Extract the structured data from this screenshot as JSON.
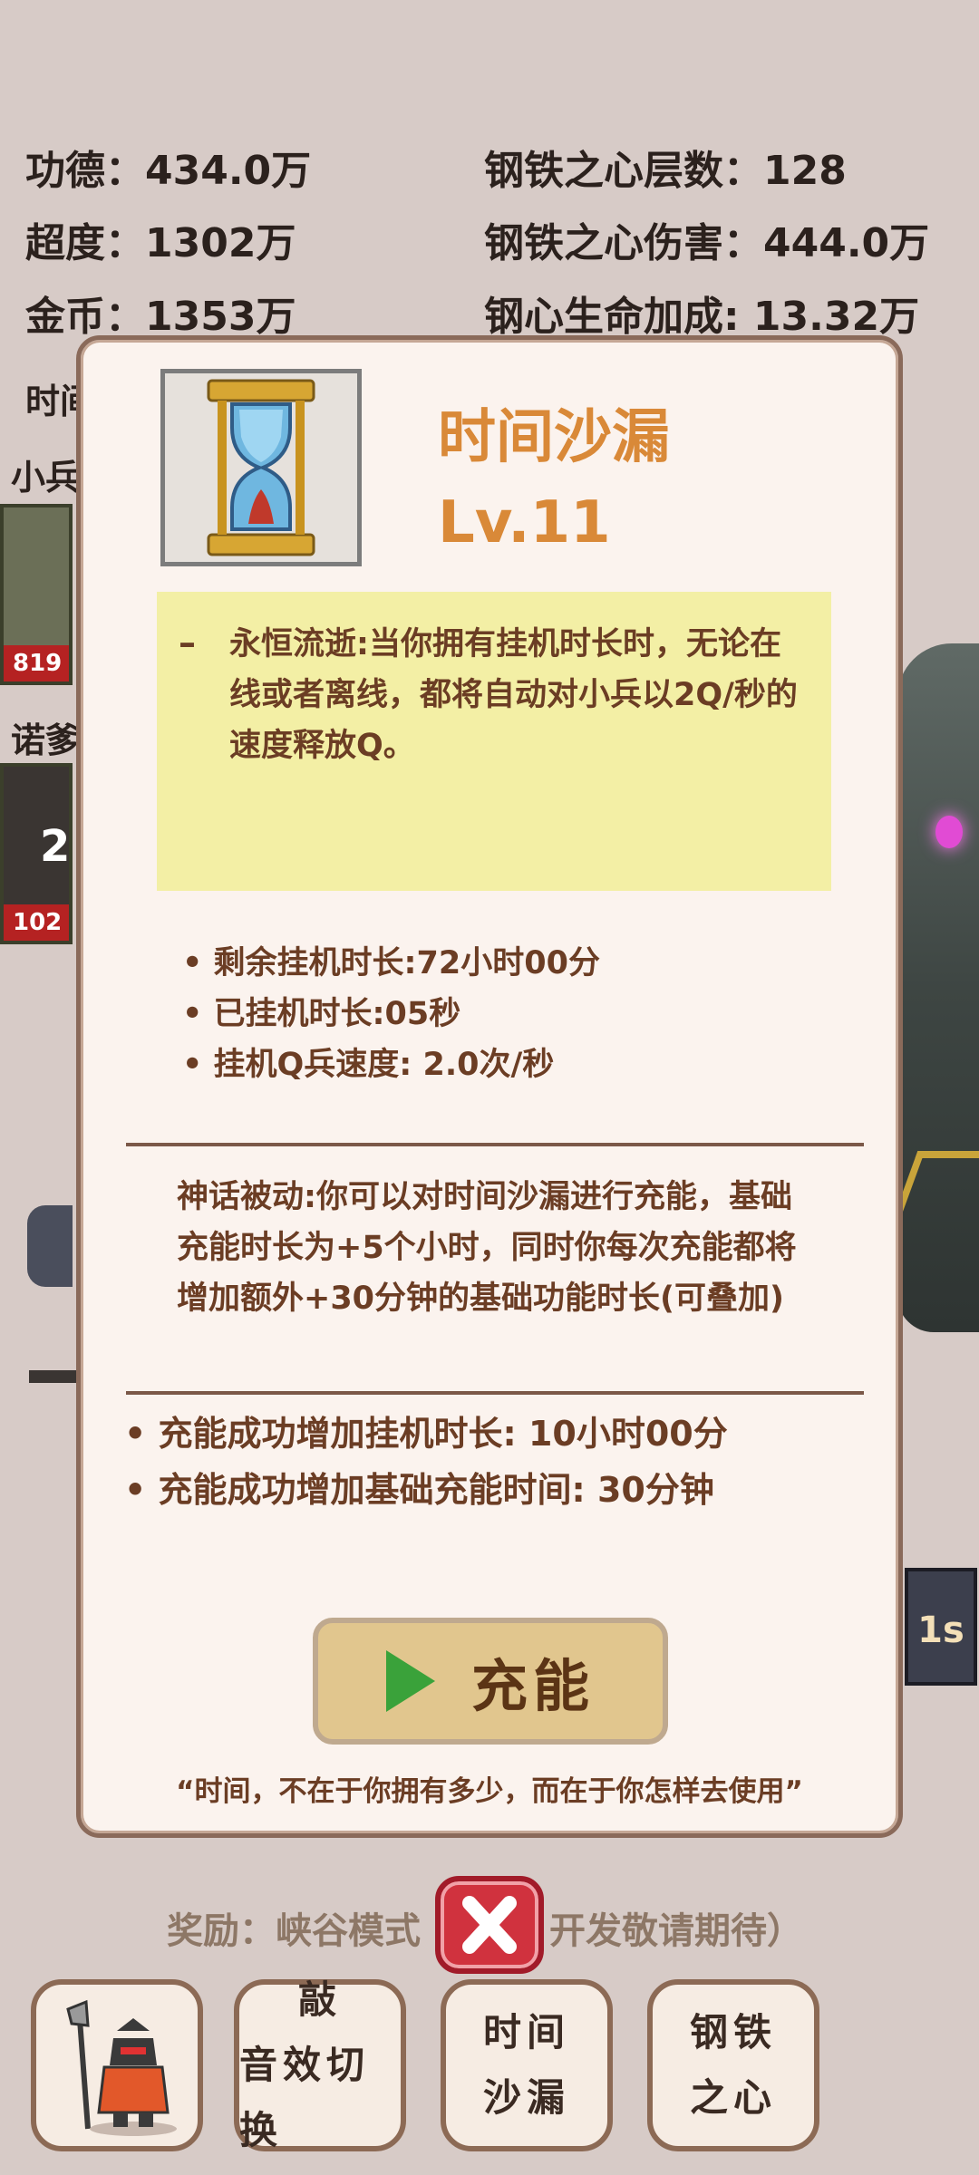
{
  "stats": {
    "merit": "功德：434.0万",
    "transcend": "超度：1302万",
    "gold": "金币：1353万",
    "iron_layers": "钢铁之心层数：128",
    "iron_damage": "钢铁之心伤害：444.0万",
    "iron_life": "钢心生命加成: 13.32万"
  },
  "background": {
    "time_label": "时间",
    "minion_label": "小兵",
    "minion_hp": "819",
    "nuo_label": "诺爹",
    "nuo_level": "2",
    "nuo_hp": "102",
    "small_icon_text": "1s",
    "reward_left": "奖励：峡谷模式",
    "reward_right": "开发敬请期待）"
  },
  "modal": {
    "title": "时间沙漏",
    "level": "Lv.11",
    "desc_dash": "–",
    "desc": "永恒流逝:当你拥有挂机时长时，无论在线或者离线，都将自动对小兵以2Q/秒的速度释放Q。",
    "stats": [
      "• 剩余挂机时长:72小时00分",
      "• 已挂机时长:05秒",
      "• 挂机Q兵速度: 2.0次/秒"
    ],
    "myth": "神话被动:你可以对时间沙漏进行充能，基础充能时长为+5个小时，同时你每次充能都将增加额外+30分钟的基础功能时长(可叠加)",
    "charge_stats": [
      "• 充能成功增加挂机时长: 10小时00分",
      "• 充能成功增加基础充能时间: 30分钟"
    ],
    "charge_button": "充能",
    "quote": "“时间，不在于你拥有多少，而在于你怎样去使用”"
  },
  "tabs": [
    {
      "line1": "敲",
      "line2": "音效切换"
    },
    {
      "line1": "时间",
      "line2": "沙漏"
    },
    {
      "line1": "钢铁",
      "line2": "之心"
    }
  ],
  "colors": {
    "background": "#d7cbc7",
    "modal": "#fbf3ee",
    "accent_title": "#d98938",
    "desc_box": "#f3efa5",
    "text_brown": "#6b3d24",
    "charge_button": "#e1c68e",
    "close_button": "#d0323e"
  }
}
